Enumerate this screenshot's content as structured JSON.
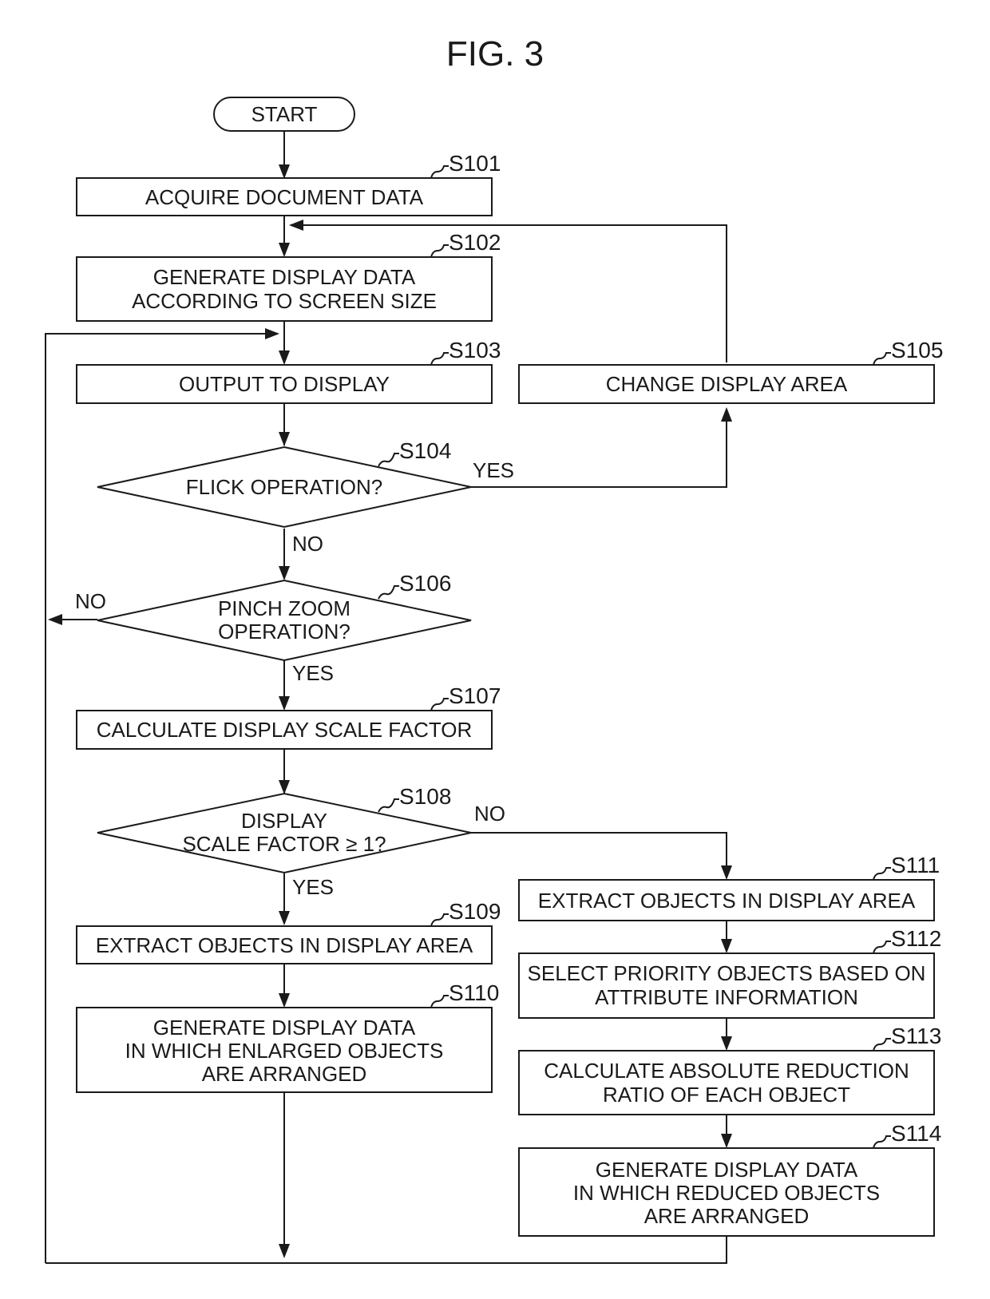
{
  "figure": {
    "title": "FIG. 3",
    "start_label": "START",
    "steps": {
      "S101": {
        "id": "S101",
        "lines": [
          "ACQUIRE DOCUMENT DATA"
        ]
      },
      "S102": {
        "id": "S102",
        "lines": [
          "GENERATE DISPLAY DATA",
          "ACCORDING TO SCREEN SIZE"
        ]
      },
      "S103": {
        "id": "S103",
        "lines": [
          "OUTPUT TO DISPLAY"
        ]
      },
      "S104": {
        "id": "S104",
        "lines": [
          "FLICK OPERATION?"
        ]
      },
      "S105": {
        "id": "S105",
        "lines": [
          "CHANGE DISPLAY AREA"
        ]
      },
      "S106": {
        "id": "S106",
        "lines": [
          "PINCH ZOOM",
          "OPERATION?"
        ]
      },
      "S107": {
        "id": "S107",
        "lines": [
          "CALCULATE DISPLAY SCALE FACTOR"
        ]
      },
      "S108": {
        "id": "S108",
        "lines": [
          "DISPLAY",
          "SCALE FACTOR ≥ 1?"
        ]
      },
      "S109": {
        "id": "S109",
        "lines": [
          "EXTRACT OBJECTS IN DISPLAY AREA"
        ]
      },
      "S110": {
        "id": "S110",
        "lines": [
          "GENERATE DISPLAY DATA",
          "IN WHICH ENLARGED OBJECTS",
          "ARE ARRANGED"
        ]
      },
      "S111": {
        "id": "S111",
        "lines": [
          "EXTRACT OBJECTS IN DISPLAY AREA"
        ]
      },
      "S112": {
        "id": "S112",
        "lines": [
          "SELECT PRIORITY OBJECTS BASED ON",
          "ATTRIBUTE INFORMATION"
        ]
      },
      "S113": {
        "id": "S113",
        "lines": [
          "CALCULATE ABSOLUTE REDUCTION",
          "RATIO OF EACH OBJECT"
        ]
      },
      "S114": {
        "id": "S114",
        "lines": [
          "GENERATE DISPLAY DATA",
          "IN WHICH REDUCED OBJECTS",
          "ARE ARRANGED"
        ]
      }
    },
    "branch_labels": {
      "s104_yes": "YES",
      "s104_no": "NO",
      "s106_no": "NO",
      "s106_yes": "YES",
      "s108_no": "NO",
      "s108_yes": "YES"
    }
  }
}
